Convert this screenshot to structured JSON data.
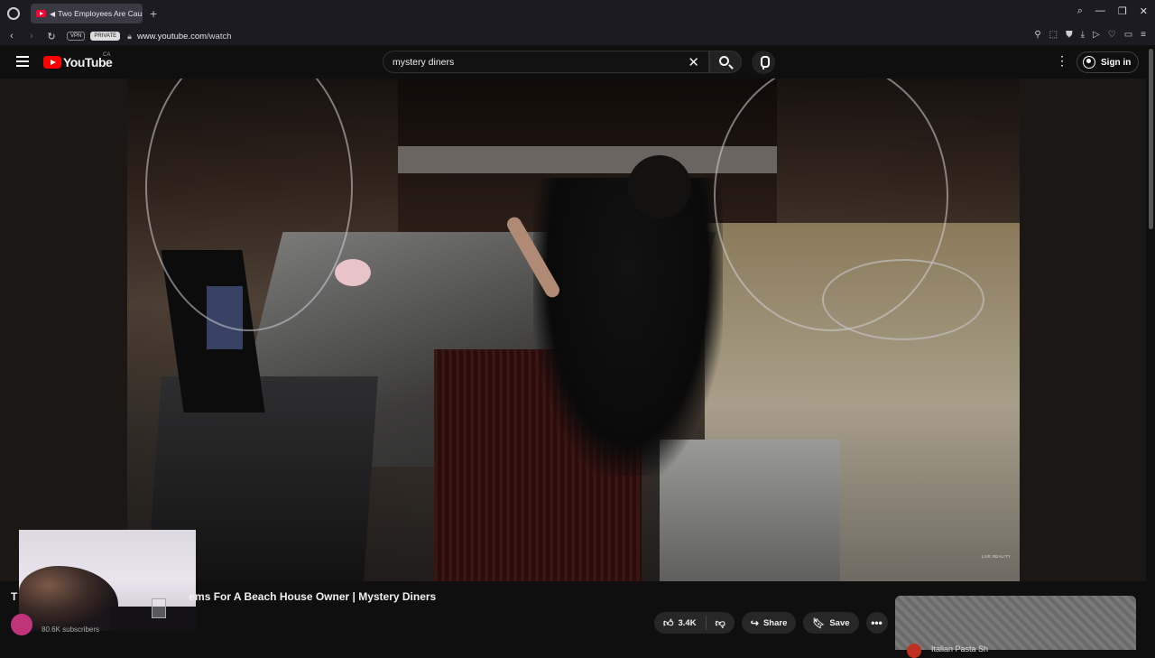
{
  "browser": {
    "tab_title": "Two Employees Are Causing Problems For A Beach House Owner | Mystery Diners",
    "new_tab_glyph": "+",
    "vpn_label": "VPN",
    "private_label": "PRIVATE",
    "url_host": "www.youtube.com",
    "url_path": "/watch"
  },
  "masthead": {
    "logo_text": "YouTube",
    "country_code": "CA",
    "search_value": "mystery diners",
    "signin_label": "Sign in"
  },
  "video": {
    "watermark": "LIVE REALITY"
  },
  "below_video": {
    "title_start": "T",
    "title_visible": "ems For A Beach House Owner | Mystery Diners",
    "subscribers": "80.6K subscribers",
    "like_count": "3.4K",
    "share_label": "Share",
    "save_label": "Save"
  },
  "sidebar": {
    "first_channel": "Italian Pasta Sh"
  },
  "colors": {
    "background": "#0f0f0f",
    "youtube_red": "#ff0000",
    "button_bg": "#272727"
  },
  "icons": [
    "hamburger-icon",
    "search-icon",
    "clear-icon",
    "mic-icon",
    "more-vert-icon",
    "user-circle-icon",
    "thumb-up-icon",
    "thumb-down-icon",
    "share-icon",
    "bookmark-icon",
    "more-horiz-icon"
  ]
}
